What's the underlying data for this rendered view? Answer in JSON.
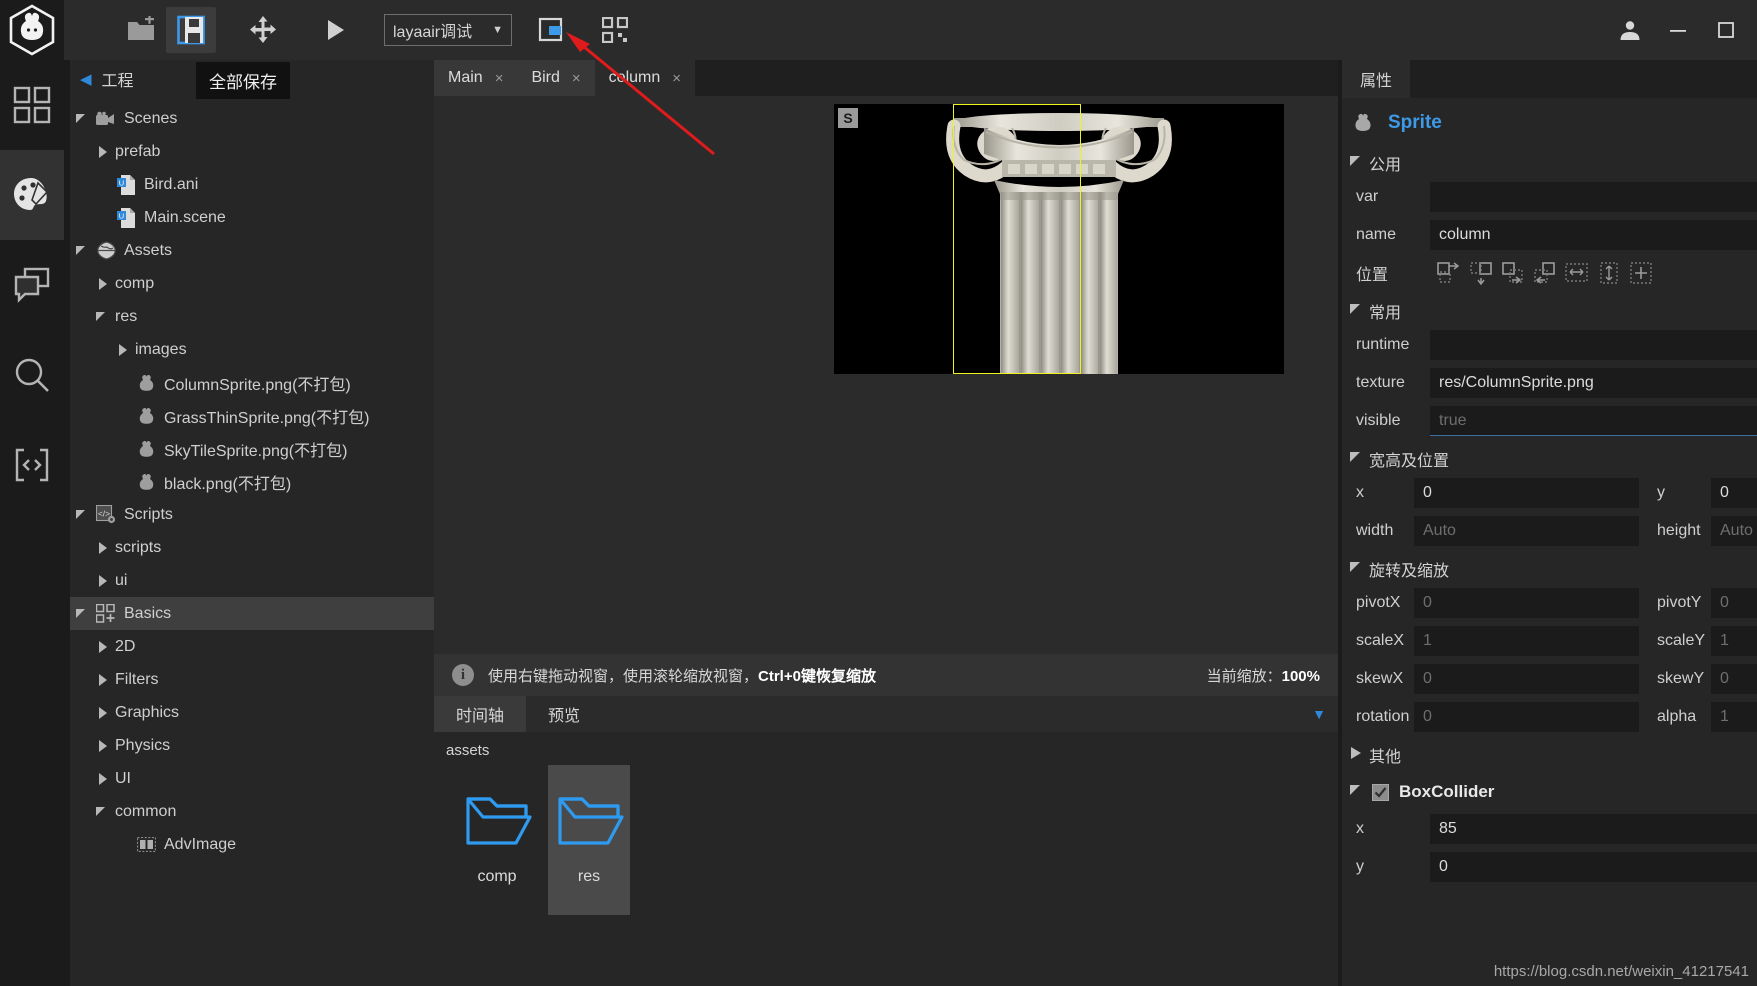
{
  "app": {
    "title": "LayaAir IDE"
  },
  "toolbar": {
    "new_label": "new-project",
    "save_all_label": "save-all",
    "transform_label": "transform",
    "run_label": "run",
    "debug_mode": "layaair调试",
    "caret": "▼",
    "export_label": "export",
    "qrcode_label": "qrcode",
    "tooltip": "全部保存"
  },
  "window_controls": {
    "account": "\u0000",
    "minimize": "—",
    "maximize": "☐"
  },
  "rail": {
    "items": [
      {
        "name": "apps-grid-icon",
        "active": false
      },
      {
        "name": "palette-icon",
        "active": true
      },
      {
        "name": "layers-icon",
        "active": false
      },
      {
        "name": "search-icon",
        "active": false
      },
      {
        "name": "code-icon",
        "active": false
      }
    ]
  },
  "project": {
    "back_caret": "◀",
    "title": "工程",
    "tree": [
      {
        "label": "Scenes",
        "indent": 0,
        "state": "down",
        "icon": "camera",
        "sel": false
      },
      {
        "label": "prefab",
        "indent": 1,
        "state": "right",
        "icon": "none",
        "sel": false
      },
      {
        "label": "Bird.ani",
        "indent": 1,
        "state": "none",
        "icon": "file-ui",
        "sel": false
      },
      {
        "label": "Main.scene",
        "indent": 1,
        "state": "none",
        "icon": "file-ui",
        "sel": false
      },
      {
        "label": "Assets",
        "indent": 0,
        "state": "down",
        "icon": "globe",
        "sel": false
      },
      {
        "label": "comp",
        "indent": 1,
        "state": "right",
        "icon": "none",
        "sel": false
      },
      {
        "label": "res",
        "indent": 1,
        "state": "down",
        "icon": "none",
        "sel": false
      },
      {
        "label": "images",
        "indent": 2,
        "state": "right",
        "icon": "none",
        "sel": false
      },
      {
        "label": "ColumnSprite.png(不打包)",
        "indent": 2,
        "state": "none",
        "icon": "laya",
        "sel": false
      },
      {
        "label": "GrassThinSprite.png(不打包)",
        "indent": 2,
        "state": "none",
        "icon": "laya",
        "sel": false
      },
      {
        "label": "SkyTileSprite.png(不打包)",
        "indent": 2,
        "state": "none",
        "icon": "laya",
        "sel": false
      },
      {
        "label": "black.png(不打包)",
        "indent": 2,
        "state": "none",
        "icon": "laya",
        "sel": false
      },
      {
        "label": "Scripts",
        "indent": 0,
        "state": "down",
        "icon": "script",
        "sel": false
      },
      {
        "label": "scripts",
        "indent": 1,
        "state": "right",
        "icon": "none",
        "sel": false
      },
      {
        "label": "ui",
        "indent": 1,
        "state": "right",
        "icon": "none",
        "sel": false
      },
      {
        "label": "Basics",
        "indent": 0,
        "state": "down",
        "icon": "grid-plus",
        "sel": true
      },
      {
        "label": "2D",
        "indent": 1,
        "state": "right",
        "icon": "none",
        "sel": false
      },
      {
        "label": "Filters",
        "indent": 1,
        "state": "right",
        "icon": "none",
        "sel": false
      },
      {
        "label": "Graphics",
        "indent": 1,
        "state": "right",
        "icon": "none",
        "sel": false
      },
      {
        "label": "Physics",
        "indent": 1,
        "state": "right",
        "icon": "none",
        "sel": false
      },
      {
        "label": "UI",
        "indent": 1,
        "state": "right",
        "icon": "none",
        "sel": false
      },
      {
        "label": "common",
        "indent": 1,
        "state": "down",
        "icon": "none",
        "sel": false
      },
      {
        "label": "AdvImage",
        "indent": 2,
        "state": "none",
        "icon": "image",
        "sel": false
      }
    ]
  },
  "editor": {
    "tabs": [
      {
        "label": "Main",
        "close": "×",
        "active": false
      },
      {
        "label": "Bird",
        "close": "×",
        "active": false
      },
      {
        "label": "column",
        "close": "×",
        "active": true
      }
    ],
    "stage_badge": "S",
    "status_hint": "使用右键拖动视窗，使用滚轮缩放视窗，",
    "status_hint_bold": "Ctrl+0键恢复缩放",
    "zoom_label": "当前缩放：",
    "zoom_value": "100%",
    "info_icon": "i"
  },
  "bottom_panel": {
    "tabs": [
      {
        "label": "时间轴",
        "active": false
      },
      {
        "label": "预览",
        "active": true
      }
    ],
    "dropdown_caret": "▼",
    "assets_path": "assets",
    "folders": [
      {
        "label": "comp",
        "selected": false
      },
      {
        "label": "res",
        "selected": true
      }
    ]
  },
  "properties": {
    "tab_label": "属性",
    "object_type": "Sprite",
    "sections": {
      "common": "公用",
      "frequent": "常用",
      "size_pos": "宽高及位置",
      "rot_scale": "旋转及缩放",
      "other": "其他"
    },
    "position_label": "位置",
    "fields": {
      "var": {
        "label": "var",
        "value": "",
        "placeholder": ""
      },
      "name": {
        "label": "name",
        "value": "column",
        "placeholder": ""
      },
      "runtime": {
        "label": "runtime",
        "value": "",
        "placeholder": ""
      },
      "texture": {
        "label": "texture",
        "value": "res/ColumnSprite.png",
        "placeholder": ""
      },
      "visible": {
        "label": "visible",
        "value": "",
        "placeholder": "true"
      },
      "x": {
        "label": "x",
        "value": "0",
        "placeholder": ""
      },
      "y": {
        "label": "y",
        "value": "0",
        "placeholder": ""
      },
      "width": {
        "label": "width",
        "value": "",
        "placeholder": "Auto"
      },
      "height": {
        "label": "height",
        "value": "",
        "placeholder": "Auto"
      },
      "pivotX": {
        "label": "pivotX",
        "value": "",
        "placeholder": "0"
      },
      "pivotY": {
        "label": "pivotY",
        "value": "",
        "placeholder": "0"
      },
      "scaleX": {
        "label": "scaleX",
        "value": "",
        "placeholder": "1"
      },
      "scaleY": {
        "label": "scaleY",
        "value": "",
        "placeholder": "1"
      },
      "skewX": {
        "label": "skewX",
        "value": "",
        "placeholder": "0"
      },
      "skewY": {
        "label": "skewY",
        "value": "",
        "placeholder": "0"
      },
      "rotation": {
        "label": "rotation",
        "value": "",
        "placeholder": "0"
      },
      "alpha": {
        "label": "alpha",
        "value": "",
        "placeholder": "1"
      }
    },
    "boxcollider": {
      "title": "BoxCollider",
      "checked": true,
      "x": {
        "label": "x",
        "value": "85"
      },
      "y": {
        "label": "y",
        "value": "0"
      }
    }
  },
  "watermark": "https://blog.csdn.net/weixin_41217541",
  "colors": {
    "accent_blue": "#3d9ae8",
    "selection_yellow": "#f2f21c",
    "arrow_red": "#e01b1b",
    "panel_bg": "#262626",
    "dark_bg": "#1b1b1b"
  }
}
